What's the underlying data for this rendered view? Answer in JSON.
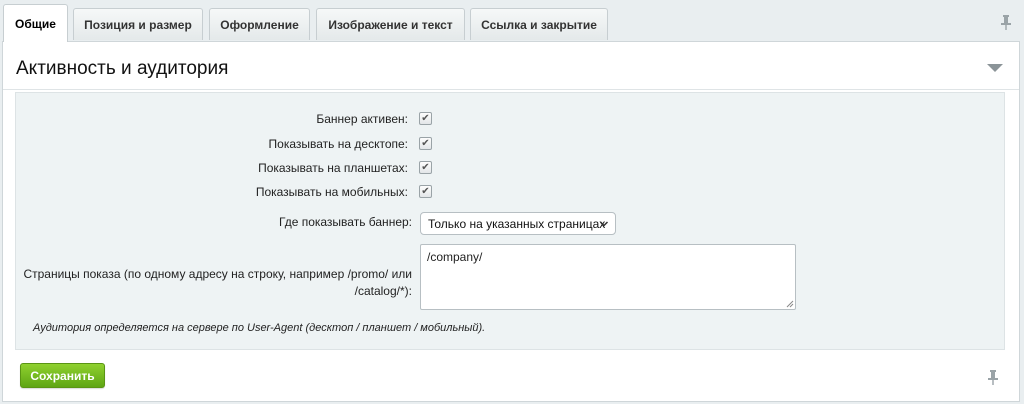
{
  "tabs": [
    {
      "label": "Общие",
      "active": true
    },
    {
      "label": "Позиция и размер",
      "active": false
    },
    {
      "label": "Оформление",
      "active": false
    },
    {
      "label": "Изображение и текст",
      "active": false
    },
    {
      "label": "Ссылка и закрытие",
      "active": false
    }
  ],
  "section": {
    "title": "Активность и аудитория"
  },
  "form": {
    "banner_active_label": "Баннер активен:",
    "banner_active_checked": true,
    "show_desktop_label": "Показывать на десктопе:",
    "show_desktop_checked": true,
    "show_tablet_label": "Показывать на планшетах:",
    "show_tablet_checked": true,
    "show_mobile_label": "Показывать на мобильных:",
    "show_mobile_checked": true,
    "where_label": "Где показывать баннер:",
    "where_value": "Только на указанных страницах",
    "pages_label_line1": "Страницы показа (по одному адресу на строку, например /promo/ или",
    "pages_label_line2": "/catalog/*):",
    "pages_value": "/company/",
    "note": "Аудитория определяется на сервере по User-Agent (десктоп / планшет / мобильный)."
  },
  "footer": {
    "save_label": "Сохранить"
  },
  "icons": {
    "pin": "pin-icon",
    "collapse": "triangle-down-icon",
    "checkmark": "checkmark-icon",
    "chevron": "chevron-down-icon"
  },
  "colors": {
    "save_button": "#6cb41c",
    "background": "#e9eef0",
    "form_area": "#eef3f4"
  }
}
